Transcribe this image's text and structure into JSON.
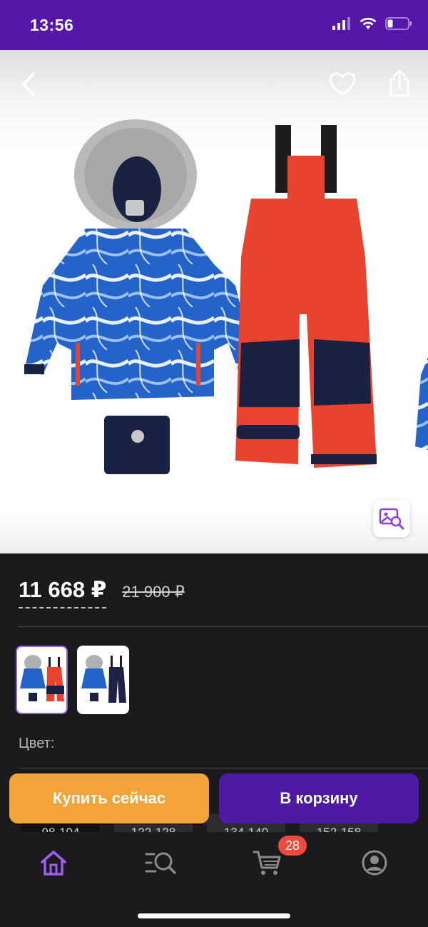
{
  "status_bar": {
    "time": "13:56"
  },
  "product": {
    "price_current": "11 668 ₽",
    "price_old": "21 900 ₽",
    "color_label": "Цвет:",
    "variants": [
      {
        "name": "blue-jacket-red-pants",
        "selected": true
      },
      {
        "name": "blue-jacket-navy-pants",
        "selected": false
      }
    ],
    "sizes": [
      "98-104",
      "122-128",
      "134-140",
      "152-158"
    ]
  },
  "actions": {
    "buy_now_label": "Купить сейчас",
    "add_to_cart_label": "В корзину"
  },
  "tab_bar": {
    "items": [
      {
        "name": "home",
        "icon": "home-icon",
        "active": true
      },
      {
        "name": "catalog",
        "icon": "catalog-search-icon",
        "active": false
      },
      {
        "name": "cart",
        "icon": "cart-icon",
        "active": false
      },
      {
        "name": "profile",
        "icon": "profile-icon",
        "active": false
      }
    ],
    "cart_badge": "28"
  },
  "colors": {
    "accent": "#5616a8",
    "buy_button": "#f2a33a",
    "cart_button": "#4f1aa3",
    "badge": "#ee4b3e",
    "active_tab": "#a05cf0"
  }
}
